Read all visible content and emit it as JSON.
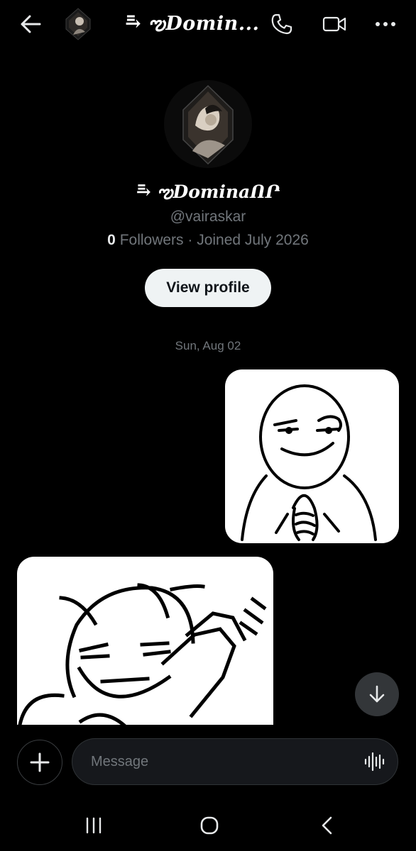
{
  "header": {
    "title": "⥱ ఌDomin...",
    "back_icon": "arrow-left-icon",
    "call_icon": "phone-icon",
    "video_icon": "video-camera-icon",
    "more_icon": "more-horizontal-icon"
  },
  "profile": {
    "display_name": "⥱ ఌDominaՈՐ",
    "handle": "@vairaskar",
    "followers_count": "0",
    "followers_label": "Followers",
    "joined": " · Joined July 2026",
    "view_profile_label": "View profile"
  },
  "conversation": {
    "date_separator": "Sun, Aug 02",
    "messages": [
      {
        "direction": "outgoing",
        "type": "image",
        "description": "smug meme face with steepled fingers"
      },
      {
        "direction": "incoming",
        "type": "image",
        "description": "pixel laughing face clapping"
      }
    ],
    "scroll_down_icon": "arrow-down-icon"
  },
  "composer": {
    "add_icon": "plus-icon",
    "placeholder": "Message",
    "voice_icon": "voice-waveform-icon"
  },
  "system_nav": {
    "recents_icon": "recents-icon",
    "home_icon": "home-icon",
    "back_icon": "chevron-left-icon"
  },
  "colors": {
    "background": "#000000",
    "text_primary": "#e7e9ea",
    "text_secondary": "#71767b",
    "button_light": "#eff3f4"
  }
}
